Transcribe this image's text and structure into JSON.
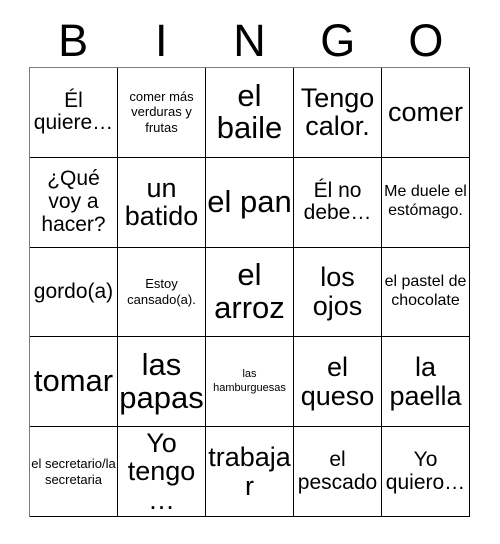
{
  "card": {
    "title": "BINGO",
    "headers": [
      "B",
      "I",
      "N",
      "G",
      "O"
    ],
    "rows": [
      [
        {
          "text": "Él quiere…",
          "size": "md"
        },
        {
          "text": "comer más verduras y frutas",
          "size": "xs"
        },
        {
          "text": "el baile",
          "size": "xxl"
        },
        {
          "text": "Tengo calor.",
          "size": "xl"
        },
        {
          "text": "comer",
          "size": "xl"
        }
      ],
      [
        {
          "text": "¿Qué voy a hacer?",
          "size": "md"
        },
        {
          "text": "un batido",
          "size": "xl"
        },
        {
          "text": "el pan",
          "size": "xxl"
        },
        {
          "text": "Él no debe…",
          "size": "md"
        },
        {
          "text": "Me duele el estómago.",
          "size": "sm"
        }
      ],
      [
        {
          "text": "gordo(a)",
          "size": "md"
        },
        {
          "text": "Estoy cansado(a).",
          "size": "xs"
        },
        {
          "text": "el arroz",
          "size": "xxl"
        },
        {
          "text": "los ojos",
          "size": "xl"
        },
        {
          "text": "el pastel de chocolate",
          "size": "sm"
        }
      ],
      [
        {
          "text": "tomar",
          "size": "xxl"
        },
        {
          "text": "las papas",
          "size": "xxl"
        },
        {
          "text": "las hamburguesas",
          "size": "xxs"
        },
        {
          "text": "el queso",
          "size": "xl"
        },
        {
          "text": "la paella",
          "size": "xl"
        }
      ],
      [
        {
          "text": "el secretario/la secretaria",
          "size": "xs"
        },
        {
          "text": "Yo tengo…",
          "size": "xl"
        },
        {
          "text": "trabajar",
          "size": "xl"
        },
        {
          "text": "el pescado",
          "size": "md"
        },
        {
          "text": "Yo quiero…",
          "size": "md"
        }
      ]
    ]
  },
  "colors": {
    "background": "#ffffff",
    "text": "#000000",
    "grid_line": "#000000",
    "grid_line_light": "#808080"
  }
}
